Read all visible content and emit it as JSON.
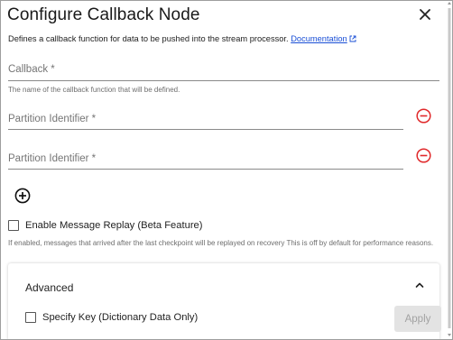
{
  "dialog": {
    "title": "Configure Callback Node",
    "description": "Defines a callback function for data to be pushed into the stream processor.",
    "doc_link": "Documentation",
    "accent_color": "#1a4fd6",
    "danger_color": "#e0282a"
  },
  "fields": {
    "callback": {
      "label": "Callback *",
      "value": "",
      "helper": "The name of the callback function that will be defined."
    },
    "partitions": [
      {
        "label": "Partition Identifier *",
        "value": ""
      },
      {
        "label": "Partition Identifier *",
        "value": ""
      }
    ]
  },
  "replay": {
    "label": "Enable Message Replay (Beta Feature)",
    "checked": false,
    "helper": "If enabled, messages that arrived after the last checkpoint will be replayed on recovery This is off by default for performance reasons."
  },
  "advanced": {
    "title": "Advanced",
    "specify_key_label": "Specify Key (Dictionary Data Only)",
    "specify_key_checked": false,
    "apply_label": "Apply"
  },
  "icons": {
    "close": "close-icon",
    "external": "external-link-icon",
    "remove": "remove-circle-icon",
    "add": "add-circle-icon",
    "collapse": "chevron-up-icon"
  }
}
